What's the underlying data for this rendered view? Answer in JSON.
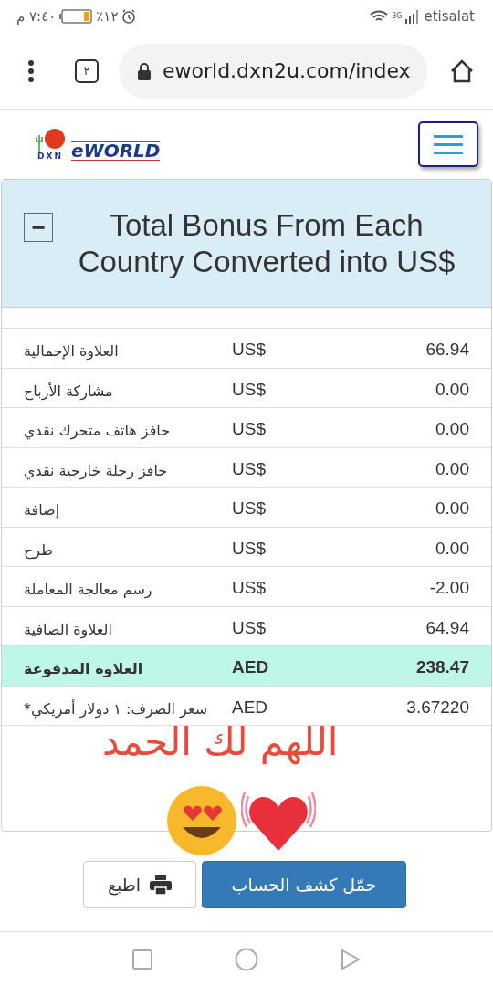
{
  "status_bar": {
    "time": "٧:٤٠ م",
    "battery": "٪١٢",
    "network": "3G",
    "carrier": "etisalat"
  },
  "browser": {
    "tab_count": "٢",
    "url": "eworld.dxn2u.com/index"
  },
  "logo": {
    "mark": "DXN",
    "name": "eWORLD"
  },
  "panel": {
    "title": "Total Bonus From Each Country Converted into US$",
    "collapse": "−",
    "expanded": true
  },
  "rows": [
    {
      "label": "العلاوة الإجمالية",
      "currency": "US$",
      "amount": "66.94",
      "highlighted": false
    },
    {
      "label": "مشاركة الأرباح",
      "currency": "US$",
      "amount": "0.00",
      "highlighted": false
    },
    {
      "label": "حافز هاتف متحرك نقدي",
      "currency": "US$",
      "amount": "0.00",
      "highlighted": false
    },
    {
      "label": "حافز رحلة خارجية نقدي",
      "currency": "US$",
      "amount": "0.00",
      "highlighted": false
    },
    {
      "label": "إضافة",
      "currency": "US$",
      "amount": "0.00",
      "highlighted": false
    },
    {
      "label": "طرح",
      "currency": "US$",
      "amount": "0.00",
      "highlighted": false
    },
    {
      "label": "رسم معالجة المعاملة",
      "currency": "US$",
      "amount": "-2.00",
      "highlighted": false
    },
    {
      "label": "العلاوة الصافية",
      "currency": "US$",
      "amount": "64.94",
      "highlighted": false
    },
    {
      "label": "العلاوة المدفوعة",
      "currency": "AED",
      "amount": "238.47",
      "highlighted": true
    },
    {
      "label": "سعر الصرف: ١ دولار أمريكي*",
      "currency": "AED",
      "amount": "3.67220",
      "highlighted": false
    }
  ],
  "annotation": "اللهم لك الحمد",
  "buttons": [
    {
      "label": "حمّل كشف الحساب",
      "kind": "primary"
    },
    {
      "label": "اطبع",
      "kind": "print"
    }
  ]
}
